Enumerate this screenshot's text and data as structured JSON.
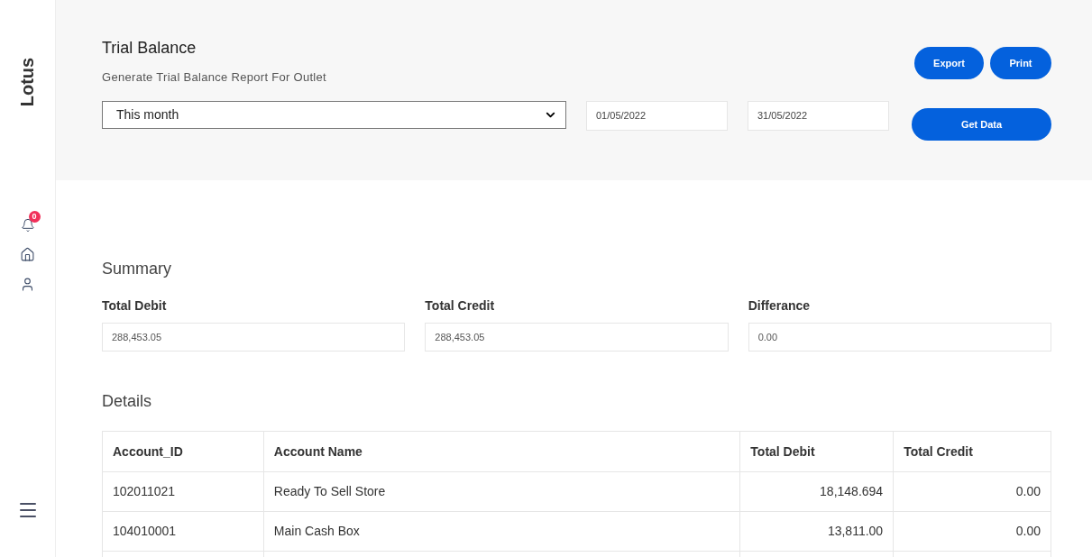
{
  "sidebar": {
    "brand": "Lotus",
    "notifications": {
      "count": "0"
    }
  },
  "header": {
    "title": "Trial Balance",
    "subtitle": "Generate Trial Balance Report For Outlet",
    "period": {
      "value": "This month"
    },
    "date_from": {
      "value": "01/05/2022"
    },
    "date_to": {
      "value": "31/05/2022"
    },
    "buttons": [
      "Export",
      "Print"
    ],
    "get_data": "Get Data"
  },
  "summary": {
    "title": "Summary",
    "fields": [
      {
        "label": "Total Debit",
        "value": "288,453.05"
      },
      {
        "label": "Total Credit",
        "value": "288,453.05"
      },
      {
        "label": "Differance",
        "value": "0.00"
      }
    ]
  },
  "details": {
    "title": "Details",
    "columns": [
      "Account_ID",
      "Account Name",
      "Total Debit",
      "Total Credit"
    ],
    "rows": [
      [
        "102011021",
        "Ready To Sell Store",
        "18,148.694",
        "0.00"
      ],
      [
        "104010001",
        "Main Cash Box",
        "13,811.00",
        "0.00"
      ]
    ]
  }
}
